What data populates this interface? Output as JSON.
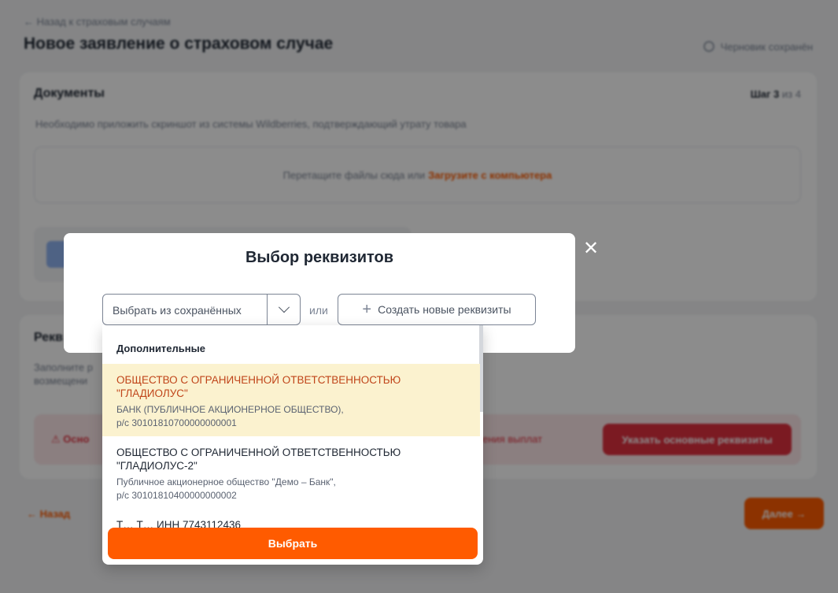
{
  "background": {
    "back_link": "← Назад к страховым случаям",
    "page_title": "Новое заявление о страховом случае",
    "draft_status": "Черновик сохранён",
    "documents": {
      "title": "Документы",
      "step_prefix": "Шаг 3",
      "step_suffix": "из 4",
      "hint": "Необходимо приложить скриншот из системы Wildberries, подтверждающий утрату товара",
      "dropzone_text": "Перетащите файлы сюда или",
      "dropzone_link": "Загрузите с компьютера"
    },
    "requisites": {
      "title": "Рекв",
      "text": "Заполните р возмещени",
      "alert_left": "Осно",
      "alert_mid": "ения выплат",
      "alert_button": "Указать основные реквизиты"
    },
    "nav_back": "← Назад",
    "nav_next": "Далее →"
  },
  "modal": {
    "title": "Выбор реквизитов",
    "select_placeholder": "Выбрать из сохранённых",
    "or_label": "или",
    "create_label": "Создать новые реквизиты",
    "close_icon": "close-icon"
  },
  "dropdown": {
    "group_label": "Дополнительные",
    "options": [
      {
        "name": "ОБЩЕСТВО С ОГРАНИЧЕННОЙ ОТВЕТСТВЕННОСТЬЮ \"ГЛАДИОЛУС\"",
        "bank": "БАНК (ПУБЛИЧНОЕ АКЦИОНЕРНОЕ ОБЩЕСТВО),",
        "account": "р/с 30101810700000000001"
      },
      {
        "name": "ОБЩЕСТВО С ОГРАНИЧЕННОЙ ОТВЕТСТВЕННОСТЬЮ \"ГЛАДИОЛУС-2\"",
        "bank": "Публичное акционерное общество \"Демо – Банк\",",
        "account": "р/с 30101810400000000002"
      },
      {
        "name": "Т… Т… ИНН 7743112436"
      }
    ],
    "choose_label": "Выбрать"
  },
  "colors": {
    "accent": "#ff5b00",
    "selected_bg": "#fbf2cf",
    "selected_text": "#c0451a",
    "error": "#e0303f"
  }
}
